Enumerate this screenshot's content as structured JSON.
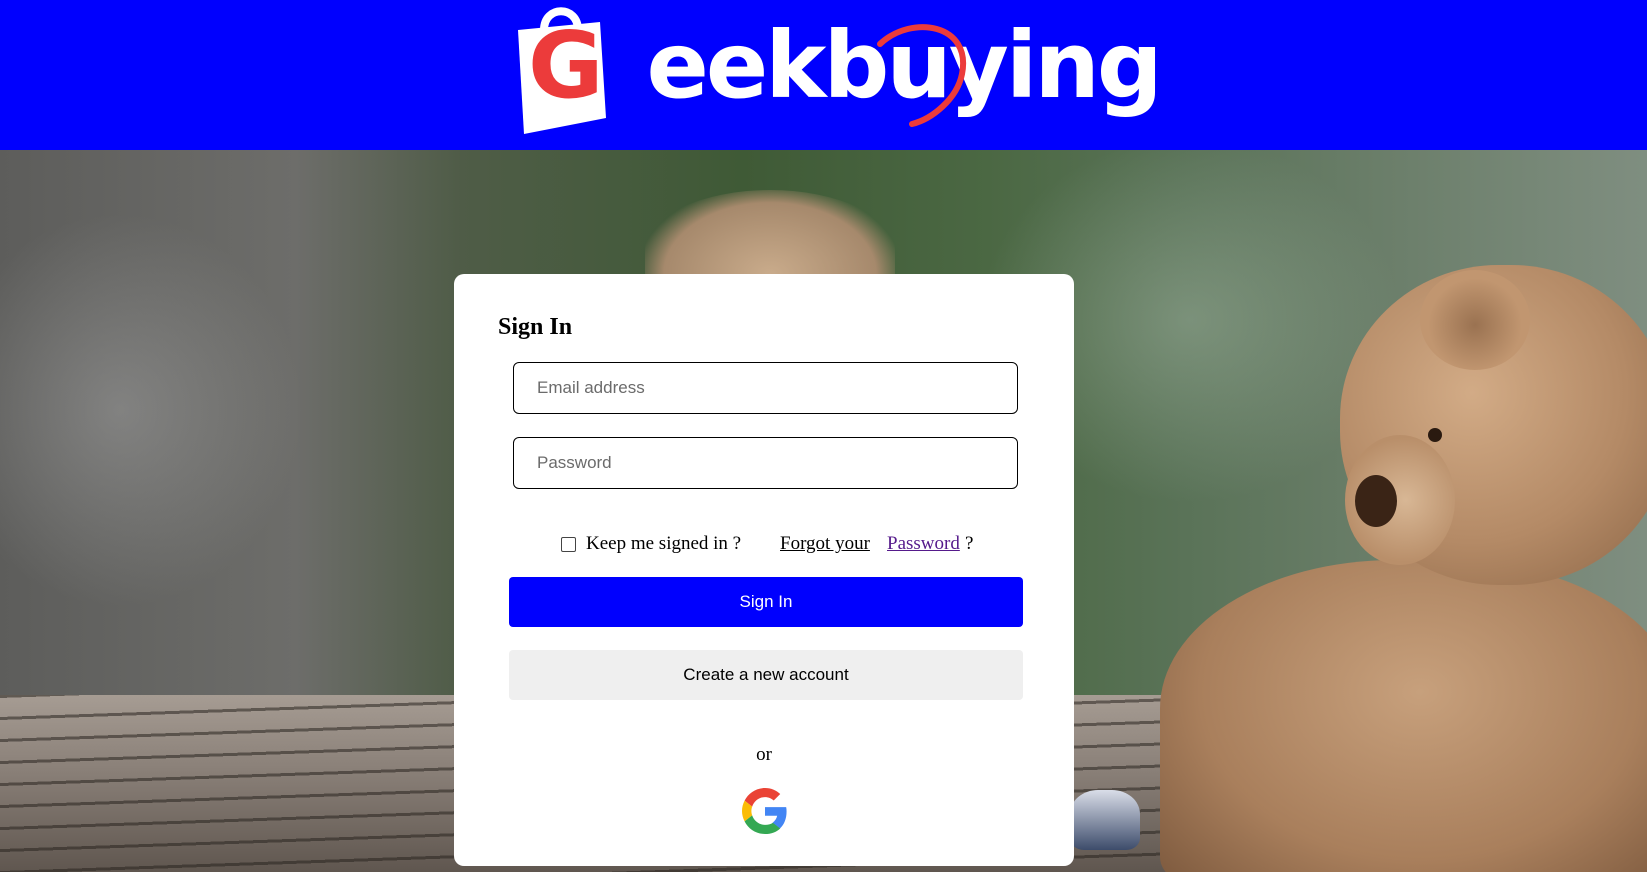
{
  "header": {
    "brand": "Geekbuying",
    "brand_first_letter": "G",
    "brand_rest": "eekbuying",
    "brand_color": "#0000fe",
    "logo_accent_color": "#ec3b3b"
  },
  "login": {
    "title": "Sign In",
    "email_placeholder": "Email address",
    "password_placeholder": "Password",
    "keep_signed_in_label": "Keep me signed in ?",
    "forgot_text": "Forgot your",
    "password_link_text": "Password",
    "question_mark": "?",
    "signin_button": "Sign In",
    "create_account_button": "Create a new account",
    "or_text": "or",
    "social_icon": "google-icon",
    "keep_signed_in_checked": false
  }
}
